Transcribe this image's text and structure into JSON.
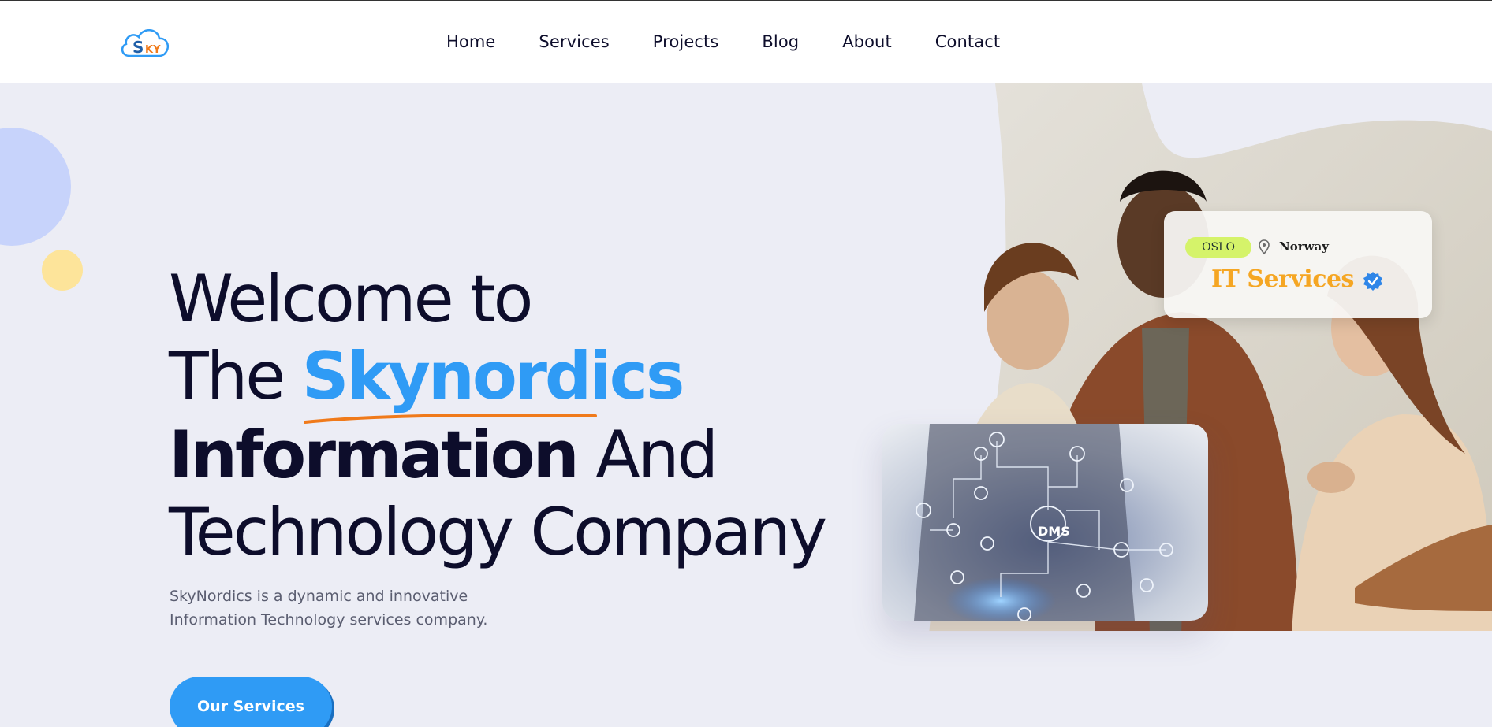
{
  "header": {
    "logo_alt": "SKY",
    "nav": [
      "Home",
      "Services",
      "Projects",
      "Blog",
      "About",
      "Contact"
    ]
  },
  "hero": {
    "line1": "Welcome to",
    "line2_prefix": "The",
    "line2_brand": "Skynordics",
    "line3_bold": "Information",
    "line3_rest": "And",
    "line4": "Technology Company",
    "subtext": "SkyNordics is a dynamic and innovative Information Technology services company.",
    "cta_label": "Our Services"
  },
  "it_card": {
    "city": "OSLO",
    "country": "Norway",
    "title": "IT Services"
  },
  "dms_card": {
    "label": "DMS"
  },
  "colors": {
    "accent": "#2f9bf5",
    "underline": "#f07a1a",
    "background": "#ecedf5",
    "pill": "#d5f36a",
    "it_title": "#f5a623"
  },
  "icons": [
    "cloud-logo-icon",
    "location-pin-icon",
    "verified-badge-icon"
  ]
}
